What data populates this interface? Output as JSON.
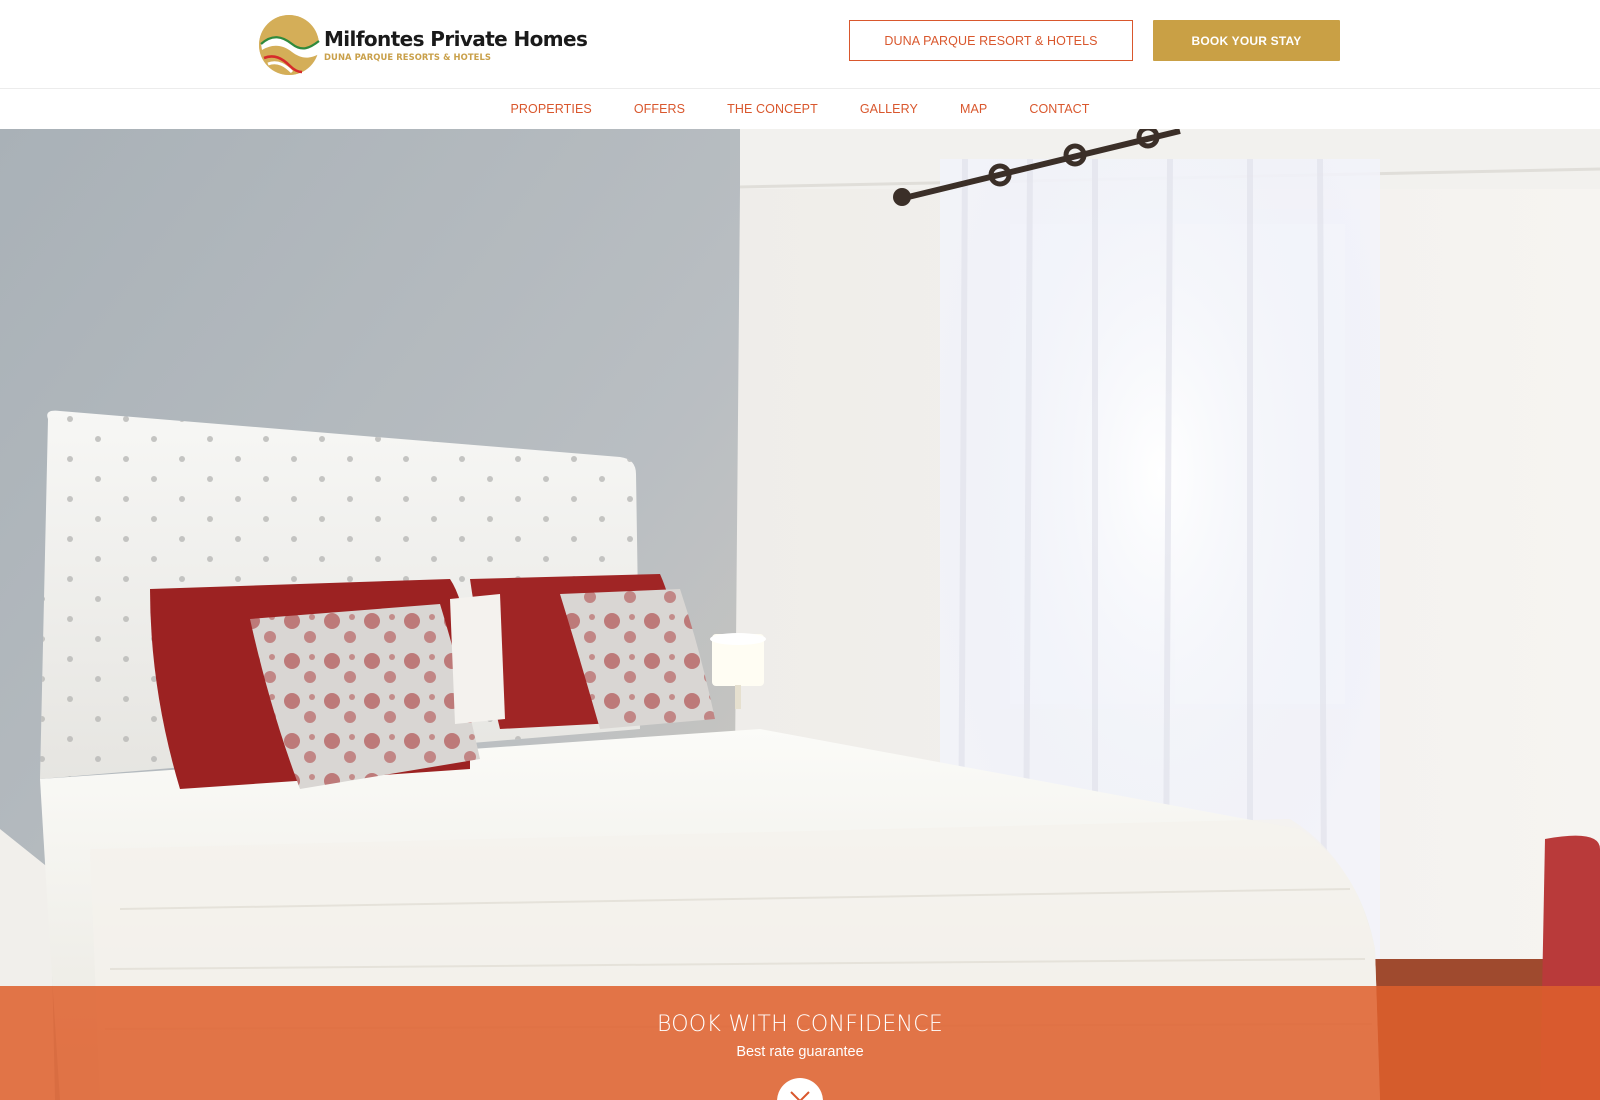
{
  "header": {
    "logo_title": "Milfontes Private Homes",
    "logo_subtitle": "DUNA PARQUE RESORTS & HOTELS",
    "resort_button_label": "DUNA PARQUE RESORT & HOTELS",
    "book_button_label": "BOOK YOUR STAY"
  },
  "nav": {
    "items": [
      {
        "label": "PROPERTIES"
      },
      {
        "label": "OFFERS"
      },
      {
        "label": "THE CONCEPT"
      },
      {
        "label": "GALLERY"
      },
      {
        "label": "MAP"
      },
      {
        "label": "CONTACT"
      }
    ]
  },
  "banner": {
    "title": "BOOK WITH CONFIDENCE",
    "subtitle": "Best rate guarantee"
  },
  "icons": {
    "scroll": "chevron-down-icon",
    "logo": "wave-logo-icon"
  },
  "colors": {
    "accent": "#d9572d",
    "gold": "#c9a045",
    "banner": "#de5f2c"
  }
}
